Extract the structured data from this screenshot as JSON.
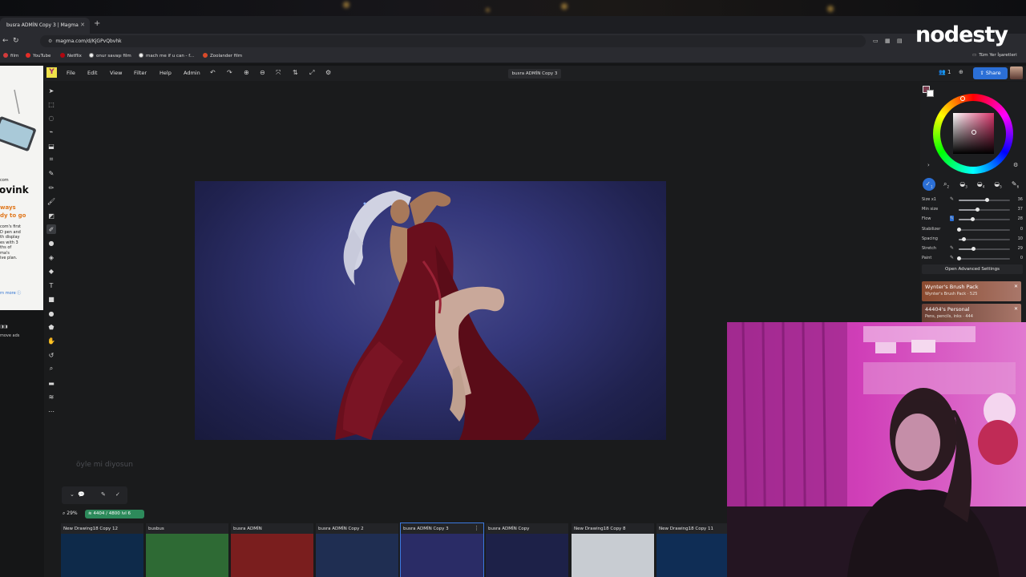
{
  "browser": {
    "tab_title": "busra ADMİN Copy 3 | Magma",
    "url": "magma.com/d/KjGPvQbvhk",
    "bookmarks": [
      "film",
      "YouTube",
      "Netflix",
      "onur savaşı film",
      "mach me if u can - f...",
      "Zoolander film"
    ],
    "bookmark_right": "Tüm Yer İşaretleri"
  },
  "overlay_logo": "nodesty",
  "ad": {
    "text_small": "com's first\nD pen and\nth display\nes with 3\nths of\nma's\nive plan.",
    "brand_line": "com",
    "brand_big": "ovink",
    "headline": "ways\ndy to go",
    "link": "rn more",
    "remove": "move ads"
  },
  "menu": {
    "items": [
      "File",
      "Edit",
      "View",
      "Filter",
      "Help",
      "Admin"
    ],
    "document_title": "busra ADMİN Copy 3",
    "users_count": "1",
    "share_label": "Share",
    "color_hex": "7b3c4f"
  },
  "brush": {
    "slots": [
      "1",
      "2",
      "3",
      "4",
      "5",
      "6",
      "7"
    ],
    "settings": [
      {
        "label": "Size x1",
        "value": "36",
        "fraction": 0.56
      },
      {
        "label": "Min size",
        "value": "37",
        "fraction": 0.37
      },
      {
        "label": "Flow",
        "value": "28",
        "fraction": 0.28
      },
      {
        "label": "Stabilizer",
        "value": "0",
        "fraction": 0.0
      },
      {
        "label": "Spacing",
        "value": "10",
        "fraction": 0.1
      },
      {
        "label": "Stretch",
        "value": "29",
        "fraction": 0.29
      },
      {
        "label": "Paint",
        "value": "0",
        "fraction": 0.0
      }
    ],
    "advanced_label": "Open Advanced Settings",
    "packs": [
      {
        "title": "Wynter's Brush Pack",
        "subtitle": "Wynter's Brush Pack · 525",
        "color": "#8a4a2f"
      },
      {
        "title": "44404's Personal",
        "subtitle": "Pens, pencils, inks · 444",
        "color": "#6a3f34"
      }
    ]
  },
  "canvas": {
    "chat_overlay": "öyle mi diyosun",
    "zoom": "29%",
    "layers_badge": "4404 / 4800  lvl 6"
  },
  "documents": [
    {
      "title": "New Drawing18 Copy 12",
      "color": "#0e2a4a"
    },
    {
      "title": "busbus",
      "color": "#2e6a34"
    },
    {
      "title": "busra ADMİN",
      "color": "#7a1e1e"
    },
    {
      "title": "busra ADMİN Copy 2",
      "color": "#1f2e52"
    },
    {
      "title": "busra ADMİN Copy 3",
      "color": "#2a2c66"
    },
    {
      "title": "busra ADMİN Copy",
      "color": "#1d2148"
    },
    {
      "title": "New Drawing18 Copy 8",
      "color": "#c8ccd2"
    },
    {
      "title": "New Drawing18 Copy 11",
      "color": "#0f2d55"
    }
  ]
}
